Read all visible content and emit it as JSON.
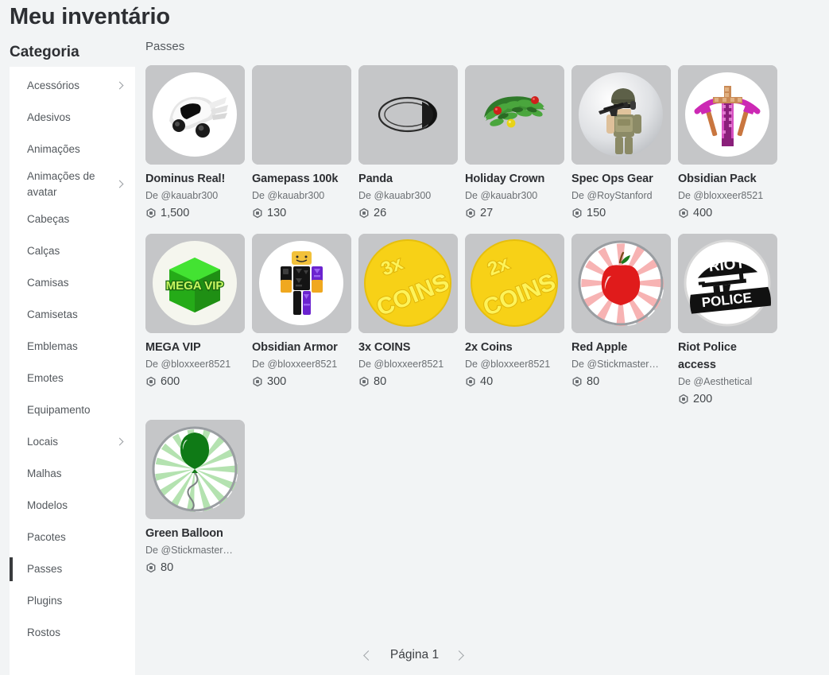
{
  "page": {
    "title": "Meu inventário",
    "background_color": "#f2f4f5"
  },
  "sidebar": {
    "heading": "Categoria",
    "selected": "Passes",
    "accent_color": "#393b3d",
    "items": [
      {
        "label": "Acessórios",
        "expandable": true
      },
      {
        "label": "Adesivos",
        "expandable": false
      },
      {
        "label": "Animações",
        "expandable": false
      },
      {
        "label": "Animações de avatar",
        "expandable": true
      },
      {
        "label": "Cabeças",
        "expandable": false
      },
      {
        "label": "Calças",
        "expandable": false
      },
      {
        "label": "Camisas",
        "expandable": false
      },
      {
        "label": "Camisetas",
        "expandable": false
      },
      {
        "label": "Emblemas",
        "expandable": false
      },
      {
        "label": "Emotes",
        "expandable": false
      },
      {
        "label": "Equipamento",
        "expandable": false
      },
      {
        "label": "Locais",
        "expandable": true
      },
      {
        "label": "Malhas",
        "expandable": false
      },
      {
        "label": "Modelos",
        "expandable": false
      },
      {
        "label": "Pacotes",
        "expandable": false
      },
      {
        "label": "Passes",
        "expandable": false
      },
      {
        "label": "Plugins",
        "expandable": false
      },
      {
        "label": "Rostos",
        "expandable": false
      }
    ]
  },
  "main": {
    "section_title": "Passes",
    "creator_prefix": "De",
    "items": [
      {
        "title": "Dominus Real!",
        "creator": "De @kauabr300",
        "price": "1,500",
        "art": "dominus"
      },
      {
        "title": "Gamepass 100k",
        "creator": "De @kauabr300",
        "price": "130",
        "art": "blank"
      },
      {
        "title": "Panda",
        "creator": "De @kauabr300",
        "price": "26",
        "art": "panda"
      },
      {
        "title": "Holiday Crown",
        "creator": "De @kauabr300",
        "price": "27",
        "art": "wreath"
      },
      {
        "title": "Spec Ops Gear",
        "creator": "De @RoyStanford",
        "price": "150",
        "art": "specops"
      },
      {
        "title": "Obsidian Pack",
        "creator": "De @bloxxeer8521",
        "price": "400",
        "art": "obsidianpack"
      },
      {
        "title": "MEGA VIP",
        "creator": "De @bloxxeer8521",
        "price": "600",
        "art": "megavip"
      },
      {
        "title": "Obsidian Armor",
        "creator": "De @bloxxeer8521",
        "price": "300",
        "art": "obsidianarmor"
      },
      {
        "title": "3x COINS",
        "creator": "De @bloxxeer8521",
        "price": "80",
        "art": "coins3x"
      },
      {
        "title": "2x Coins",
        "creator": "De @bloxxeer8521",
        "price": "40",
        "art": "coins2x"
      },
      {
        "title": "Red Apple",
        "creator": "De @Stickmaster…",
        "price": "80",
        "art": "apple"
      },
      {
        "title": "Riot Police access",
        "creator": "De @Aesthetical",
        "price": "200",
        "art": "riot"
      },
      {
        "title": "Green Balloon",
        "creator": "De @Stickmaster…",
        "price": "80",
        "art": "balloon"
      }
    ]
  },
  "pagination": {
    "prev_icon": "chevron-left-icon",
    "next_icon": "chevron-right-icon",
    "label": "Página 1"
  }
}
